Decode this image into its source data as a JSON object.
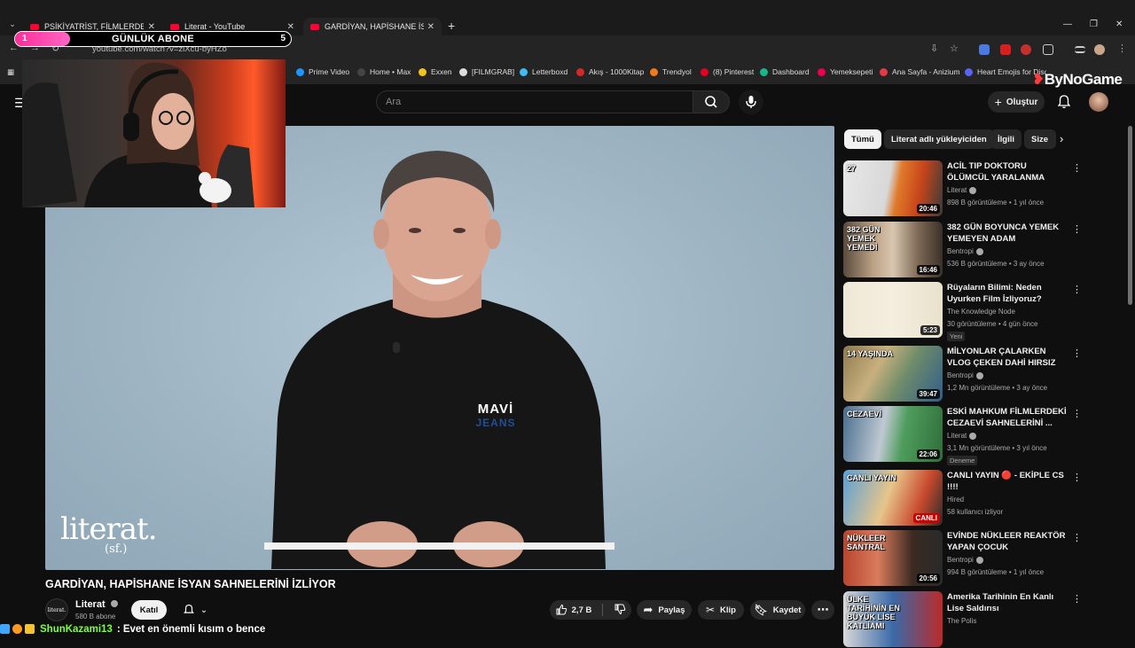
{
  "browser": {
    "tabs": [
      {
        "title": "PSİKİYATRİST, FİLMLERDEKİ SEF",
        "active": false
      },
      {
        "title": "Literat - YouTube",
        "active": false
      },
      {
        "title": "GARDİYAN, HAPİSHANE İSYAN",
        "active": true
      }
    ],
    "url": "youtube.com/watch?v=zlXcu-byHZo",
    "bookmarks": [
      {
        "label": "Prime Video",
        "color": "#1a98ff"
      },
      {
        "label": "Home • Max",
        "color": "#444444"
      },
      {
        "label": "Exxen",
        "color": "#f0c419"
      },
      {
        "label": "[FILMGRAB]",
        "color": "#dddddd"
      },
      {
        "label": "Letterboxd",
        "color": "#40bcf4"
      },
      {
        "label": "Akış - 1000Kitap",
        "color": "#d62828"
      },
      {
        "label": "Trendyol",
        "color": "#f27a1a"
      },
      {
        "label": "(8) Pinterest",
        "color": "#e60023"
      },
      {
        "label": "Dashboard",
        "color": "#14b88f"
      },
      {
        "label": "Yemeksepeti",
        "color": "#ea004b"
      },
      {
        "label": "Ana Sayfa - Anizium",
        "color": "#e63946"
      },
      {
        "label": "Heart Emojis for Disc",
        "color": "#5865f2"
      }
    ]
  },
  "overlay": {
    "goal_title": "GÜNLÜK ABONE",
    "goal_current": "1",
    "goal_target": "5",
    "goal_progress": 0.2,
    "watermark": "ByNoGame",
    "chat_user": "ShunKazami13",
    "chat_message": ": Evet en önemli kısım o bence"
  },
  "youtube": {
    "search_placeholder": "Ara",
    "create_label": "Oluştur",
    "video_title": "GARDİYAN, HAPİSHANE İSYAN SAHNELERİNİ İZLİYOR",
    "player_logo": "literat.",
    "player_logo_sub": "(sf.)",
    "shirt_text_1": "MAVİ",
    "shirt_text_2": "JEANS",
    "channel_name": "Literat",
    "channel_avatar_text": "literat.",
    "channel_subs": "580 B abone",
    "join_label": "Katıl",
    "like_count": "2,7 B",
    "share_label": "Paylaş",
    "clip_label": "Klip",
    "save_label": "Kaydet"
  },
  "sidebar": {
    "chips": [
      "Tümü",
      "Literat adlı yükleyiciden",
      "İlgili",
      "Size"
    ],
    "recs": [
      {
        "title": "ACİL TIP DOKTORU ÖLÜMCÜL YARALANMA SAHNELERİNİ ...",
        "channel": "Literat",
        "verified": true,
        "meta": "898 B görüntüleme • 1 yıl önce",
        "duration": "20:46",
        "tag": "",
        "thumb": "linear-gradient(100deg,#e8e8e8 0%,#d8d8d8 45%,#e07a2a 55%,#c7451b 75%,#3a3a3a 100%)",
        "thumb_text": "27"
      },
      {
        "title": "382 GÜN BOYUNCA YEMEK YEMEYEN ADAM",
        "channel": "Bentropi",
        "verified": true,
        "meta": "536 B görüntüleme • 3 ay önce",
        "duration": "16:46",
        "tag": "",
        "thumb": "linear-gradient(90deg,#5a4b3d 0%,#bba185 30%,#d9c6b0 50%,#7e6a56 75%,#3b3029 100%)",
        "thumb_text": "382 GÜN YEMEK YEMEDİ"
      },
      {
        "title": "Rüyaların Bilimi: Neden Uyurken Film İzliyoruz?",
        "channel": "The Knowledge Node",
        "verified": false,
        "meta": "30 görüntüleme • 4 gün önce",
        "duration": "5:23",
        "tag": "Yeni",
        "thumb": "linear-gradient(90deg,#efe8d6 0%,#f4eedf 50%,#e9e1cb 100%)",
        "thumb_text": ""
      },
      {
        "title": "MİLYONLAR ÇALARKEN VLOG ÇEKEN DAHİ HIRSIZ",
        "channel": "Bentropi",
        "verified": true,
        "meta": "1,2 Mn görüntüleme • 3 ay önce",
        "duration": "39:47",
        "tag": "",
        "thumb": "linear-gradient(120deg,#8f7a4e 0%,#c8b07e 35%,#6f8c6a 60%,#2f5d8a 100%)",
        "thumb_text": "14 YAŞINDA"
      },
      {
        "title": "ESKİ MAHKUM FİLMLERDEKİ CEZAEVİ SAHNELERİNİ ...",
        "channel": "Literat",
        "verified": true,
        "meta": "3,1 Mn görüntüleme • 3 yıl önce",
        "duration": "22:06",
        "tag": "Deneme",
        "thumb": "linear-gradient(100deg,#4a6f8f 0%,#bfc9d2 40%,#4f9d5d 60%,#2f6e3a 100%)",
        "thumb_text": "CEZAEVİ"
      },
      {
        "title": "CANLI YAYIN 🔴 - EKİPLE CS !!!!",
        "channel": "Hired",
        "verified": false,
        "meta": "58 kullanıcı izliyor",
        "duration": "CANLI",
        "tag": "",
        "thumb": "linear-gradient(110deg,#5aa0d8 0%,#e7c58a 45%,#c94a2e 75%,#2a2a2a 100%)",
        "thumb_text": "CANLI YAYIN"
      },
      {
        "title": "EVİNDE NÜKLEER REAKTÖR YAPAN ÇOCUK",
        "channel": "Bentropi",
        "verified": true,
        "meta": "994 B görüntüleme • 1 yıl önce",
        "duration": "20:56",
        "tag": "",
        "thumb": "linear-gradient(90deg,#b8462e 0%,#d97b5c 35%,#3a2a22 70%,#2a2a2a 100%)",
        "thumb_text": "NÜKLEER SANTRAL"
      },
      {
        "title": "Amerika Tarihinin En Kanlı Lise Saldırısı",
        "channel": "The Polis",
        "verified": false,
        "meta": "",
        "duration": "",
        "tag": "",
        "thumb": "linear-gradient(90deg,#d9d9d9 0%,#3a6aa8 50%,#bb2a2a 100%)",
        "thumb_text": "ÜLKE TARİHİNİN EN BÜYÜK LİSE KATLİAMI"
      }
    ]
  },
  "colors": {
    "accent": "#ff0033",
    "goal_fill": "#ff2d9a",
    "chat_user": "#7dff3d"
  }
}
